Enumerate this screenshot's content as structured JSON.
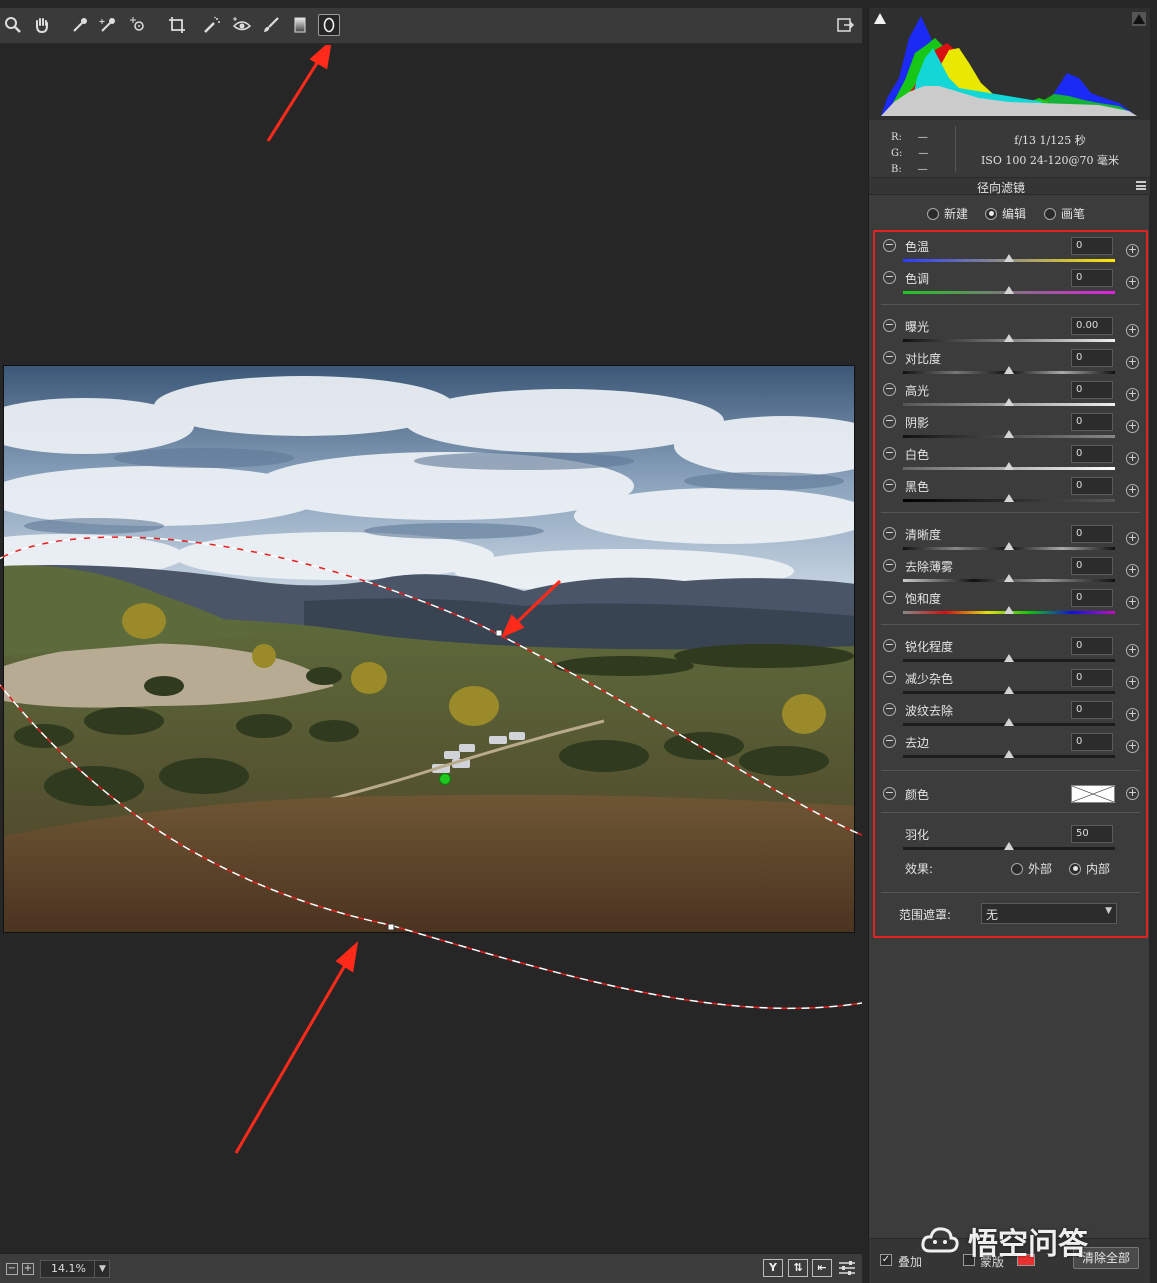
{
  "toolbar": {
    "tools": [
      "zoom-icon",
      "hand-icon",
      "white-balance-eyedropper-icon",
      "color-sampler-icon",
      "target-adjustment-icon",
      "crop-straighten-icon",
      "spot-removal-icon",
      "red-eye-icon",
      "adjustment-brush-icon",
      "graduated-filter-icon",
      "radial-filter-icon"
    ],
    "active_tool": "radial-filter-icon",
    "right_icon": "open-preferences-icon"
  },
  "info": {
    "r_label": "R:",
    "g_label": "G:",
    "b_label": "B:",
    "r_value": "—",
    "g_value": "—",
    "b_value": "—",
    "aperture_shutter": "f/13   1/125 秒",
    "iso_lens": "ISO 100   24-120@70 毫米"
  },
  "filter": {
    "title": "径向滤镜",
    "modes": [
      {
        "label": "新建",
        "selected": false
      },
      {
        "label": "编辑",
        "selected": true
      },
      {
        "label": "画笔",
        "selected": false
      }
    ]
  },
  "sliders": {
    "temperature": {
      "label": "色温",
      "value": "0",
      "level": 0.5
    },
    "tint": {
      "label": "色调",
      "value": "0",
      "level": 0.5
    },
    "exposure": {
      "label": "曝光",
      "value": "0.00",
      "level": 0.5
    },
    "contrast": {
      "label": "对比度",
      "value": "0",
      "level": 0.5
    },
    "highlights": {
      "label": "高光",
      "value": "0",
      "level": 0.5
    },
    "shadows": {
      "label": "阴影",
      "value": "0",
      "level": 0.5
    },
    "whites": {
      "label": "白色",
      "value": "0",
      "level": 0.5
    },
    "blacks": {
      "label": "黑色",
      "value": "0",
      "level": 0.5
    },
    "clarity": {
      "label": "清晰度",
      "value": "0",
      "level": 0.5
    },
    "dehaze": {
      "label": "去除薄雾",
      "value": "0",
      "level": 0.5
    },
    "saturation": {
      "label": "饱和度",
      "value": "0",
      "level": 0.5
    },
    "sharpness": {
      "label": "锐化程度",
      "value": "0",
      "level": 0.5
    },
    "noise": {
      "label": "减少杂色",
      "value": "0",
      "level": 0.5
    },
    "moire": {
      "label": "波纹去除",
      "value": "0",
      "level": 0.5
    },
    "defringe": {
      "label": "去边",
      "value": "0",
      "level": 0.5
    }
  },
  "color": {
    "label": "颜色"
  },
  "feather": {
    "label": "羽化",
    "value": "50",
    "level": 0.5
  },
  "effect": {
    "label": "效果:",
    "options": [
      {
        "label": "外部",
        "selected": false
      },
      {
        "label": "内部",
        "selected": true
      }
    ]
  },
  "range_mask": {
    "label": "范围遮罩:",
    "value": "无"
  },
  "bottom": {
    "overlay_label": "叠加",
    "overlay_checked": true,
    "mask_label": "蒙版",
    "mask_checked": false,
    "mask_color": "#e83030",
    "clear_label": "清除全部"
  },
  "statusbar": {
    "zoom_out": "−",
    "zoom_in": "+",
    "zoom": "14.1%",
    "view_y": "Y",
    "view_swap": "⇅",
    "view_copy": "⇤"
  },
  "watermark": {
    "text": "悟空问答"
  },
  "colors": {
    "annotation_red": "#ff2a1a",
    "highlight_border": "#e32222",
    "panel_bg": "#3c3c3c",
    "canvas_bg": "#262626"
  }
}
